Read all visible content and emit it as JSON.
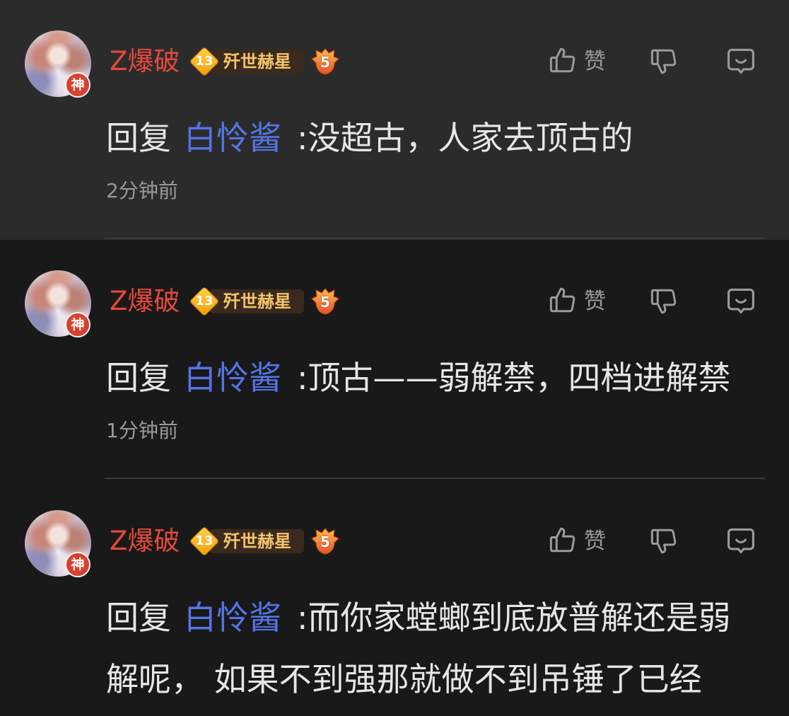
{
  "colors": {
    "highlight_bg": "#2b2b2b",
    "page_bg": "#191919",
    "username": "#e4493c",
    "mention": "#5574e6",
    "text": "#e6e6e6",
    "muted": "#9a9a9a",
    "divider": "#3a3a3a",
    "medal_bg": "#3a2a1d",
    "medal_text": "#f5c46c",
    "god_badge": "#d8412f"
  },
  "icons": {
    "like": "thumbs-up-icon",
    "dislike": "thumbs-down-icon",
    "reply": "comment-icon",
    "level": "diamond-level-icon",
    "fan": "flame-badge-icon"
  },
  "comments": [
    {
      "highlighted": true,
      "username": "Z爆破",
      "avatar_badge": "神",
      "level": "13",
      "medal_name": "歼世赫星",
      "fan_badge": "5",
      "like_label": "赞",
      "reply_prefix": "回复",
      "reply_to": "白怜酱",
      "content": ":没超古，人家去顶古的",
      "time": "2分钟前"
    },
    {
      "highlighted": false,
      "username": "Z爆破",
      "avatar_badge": "神",
      "level": "13",
      "medal_name": "歼世赫星",
      "fan_badge": "5",
      "like_label": "赞",
      "reply_prefix": "回复",
      "reply_to": "白怜酱",
      "content": ":顶古——弱解禁，四档进解禁",
      "time": "1分钟前"
    },
    {
      "highlighted": false,
      "username": "Z爆破",
      "avatar_badge": "神",
      "level": "13",
      "medal_name": "歼世赫星",
      "fan_badge": "5",
      "like_label": "赞",
      "reply_prefix": "回复",
      "reply_to": "白怜酱",
      "content": ":而你家螳螂到底放普解还是弱解呢， 如果不到强那就做不到吊锤了已经"
    }
  ]
}
